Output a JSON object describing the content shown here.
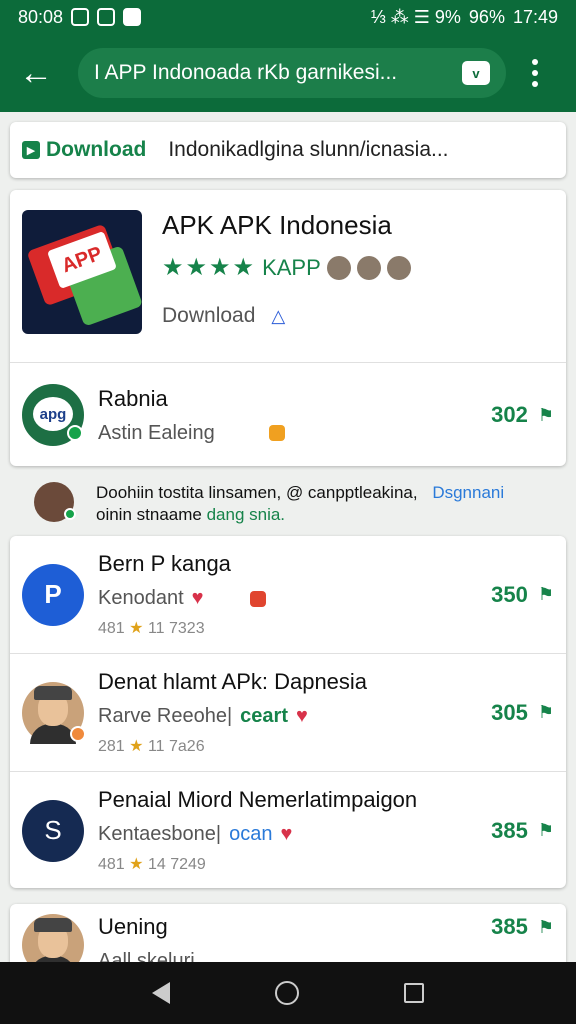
{
  "status_bar": {
    "time_left": "80:08",
    "icons_text": "⅓ ⁂ ☰ 9% ",
    "battery": "96%",
    "time_right": "17:49"
  },
  "app_bar": {
    "search_text": "I APP Indonoada rKb garnikesi..."
  },
  "download_banner": {
    "tag": "Download",
    "text": "Indonikadlgina slunn/icnasia..."
  },
  "featured": {
    "title": "APK APK Indonesia",
    "logo_text": "APP",
    "rating_label": "KAPP",
    "download_label": "Download",
    "row": {
      "title": "Rabnia",
      "subtitle": "Astin Ealeing",
      "count": "302",
      "avatar_text": "apg"
    }
  },
  "notice": {
    "line1": "Doohiin tostita linsamen,",
    "line1_link": "@ canpptleakina,",
    "line1_tag": "Dsgnnani",
    "line2": "oinin stnaame",
    "line2_green": "dang snia."
  },
  "list": [
    {
      "title": "Bern P kanga",
      "subtitle": "Kenodant",
      "meta": "481",
      "meta2": "11 7323",
      "count": "350",
      "avatar_text": "P"
    },
    {
      "title": "Denat hlamt APk: Dapnesia",
      "subtitle": "Rarve Reeohe|",
      "tag": "ceart",
      "meta": "281",
      "meta2": "11 7a26",
      "count": "305"
    },
    {
      "title": "Penaial Miord Nemerlatimpaigon",
      "subtitle": "Kentaesbone|",
      "tag": "ocan",
      "meta": "481",
      "meta2": "14 7249",
      "count": "385",
      "avatar_text": "S"
    }
  ],
  "last": {
    "title": "Uening",
    "count": "385",
    "subtitle": "Aall skeluri"
  },
  "colors": {
    "brand_green": "#0c6b3a",
    "accent_green": "#16834a",
    "link_blue": "#2a7ad9"
  }
}
